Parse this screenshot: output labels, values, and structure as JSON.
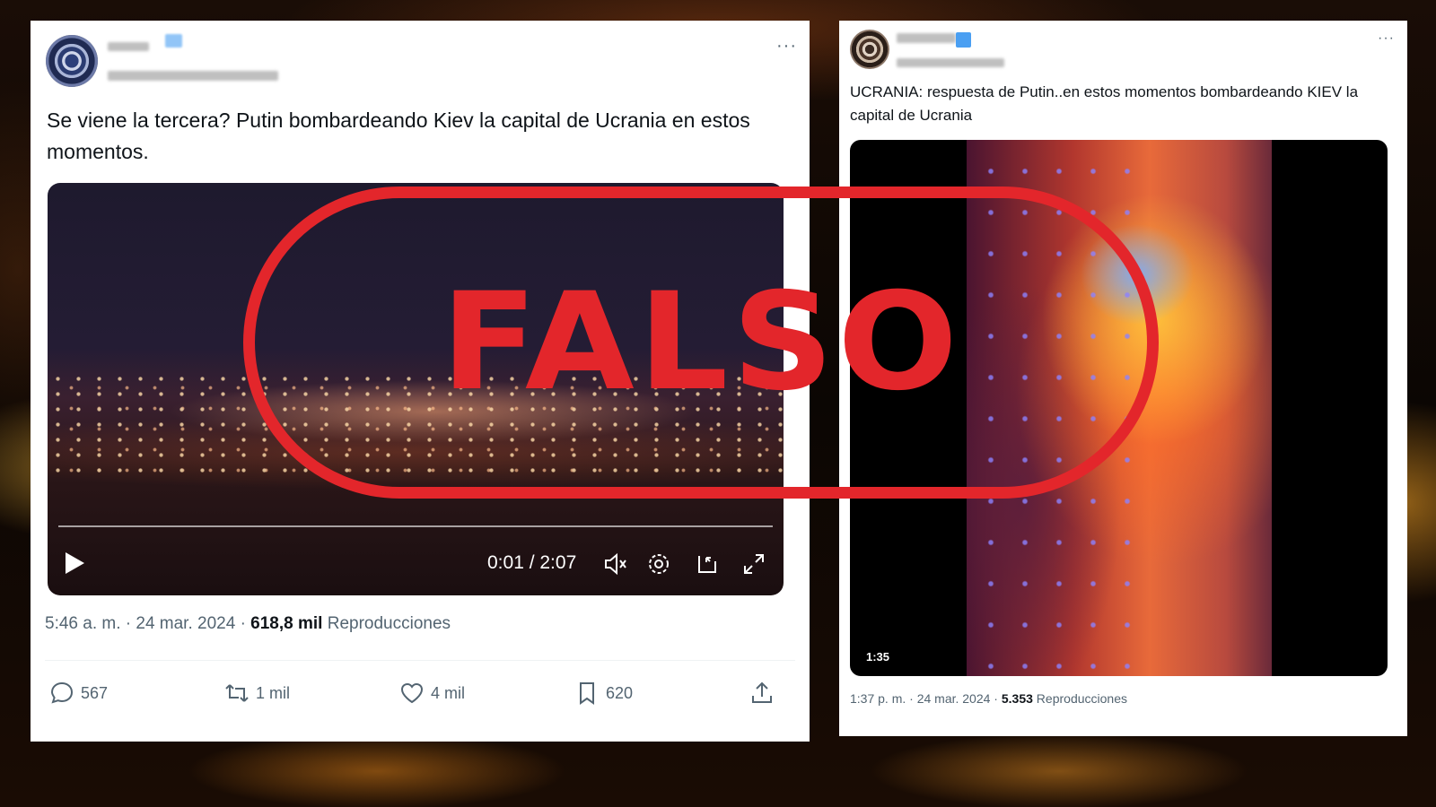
{
  "tweet1": {
    "more_label": "···",
    "text": "Se viene la tercera? Putin bombardeando Kiev la capital de Ucrania en estos momentos.",
    "video_time": "0:01 / 2:07",
    "meta_time": "5:46 a. m. · 24 mar. 2024 · ",
    "views_count": "618,8 mil",
    "views_label": " Reproducciones",
    "actions": {
      "replies": "567",
      "reposts": "1 mil",
      "likes": "4 mil",
      "bookmarks": "620"
    },
    "icons": [
      "play-icon",
      "mute-icon",
      "settings-icon",
      "pip-icon",
      "fullscreen-icon",
      "reply-icon",
      "repost-icon",
      "like-icon",
      "bookmark-icon",
      "share-icon"
    ]
  },
  "tweet2": {
    "more_label": "···",
    "text": "UCRANIA: respuesta de Putin..en estos momentos bombardeando KIEV la capital de Ucrania",
    "video_duration": "1:35",
    "meta_time": "1:37 p. m. · 24 mar. 2024 · ",
    "views_count": "5.353",
    "views_label": " Reproducciones"
  },
  "stamp": {
    "text": "FALSO",
    "color": "#e3262b"
  },
  "colors": {
    "verified_badge": "#4a9ff2",
    "muted_text": "#536471",
    "primary_text": "#0f1419"
  }
}
